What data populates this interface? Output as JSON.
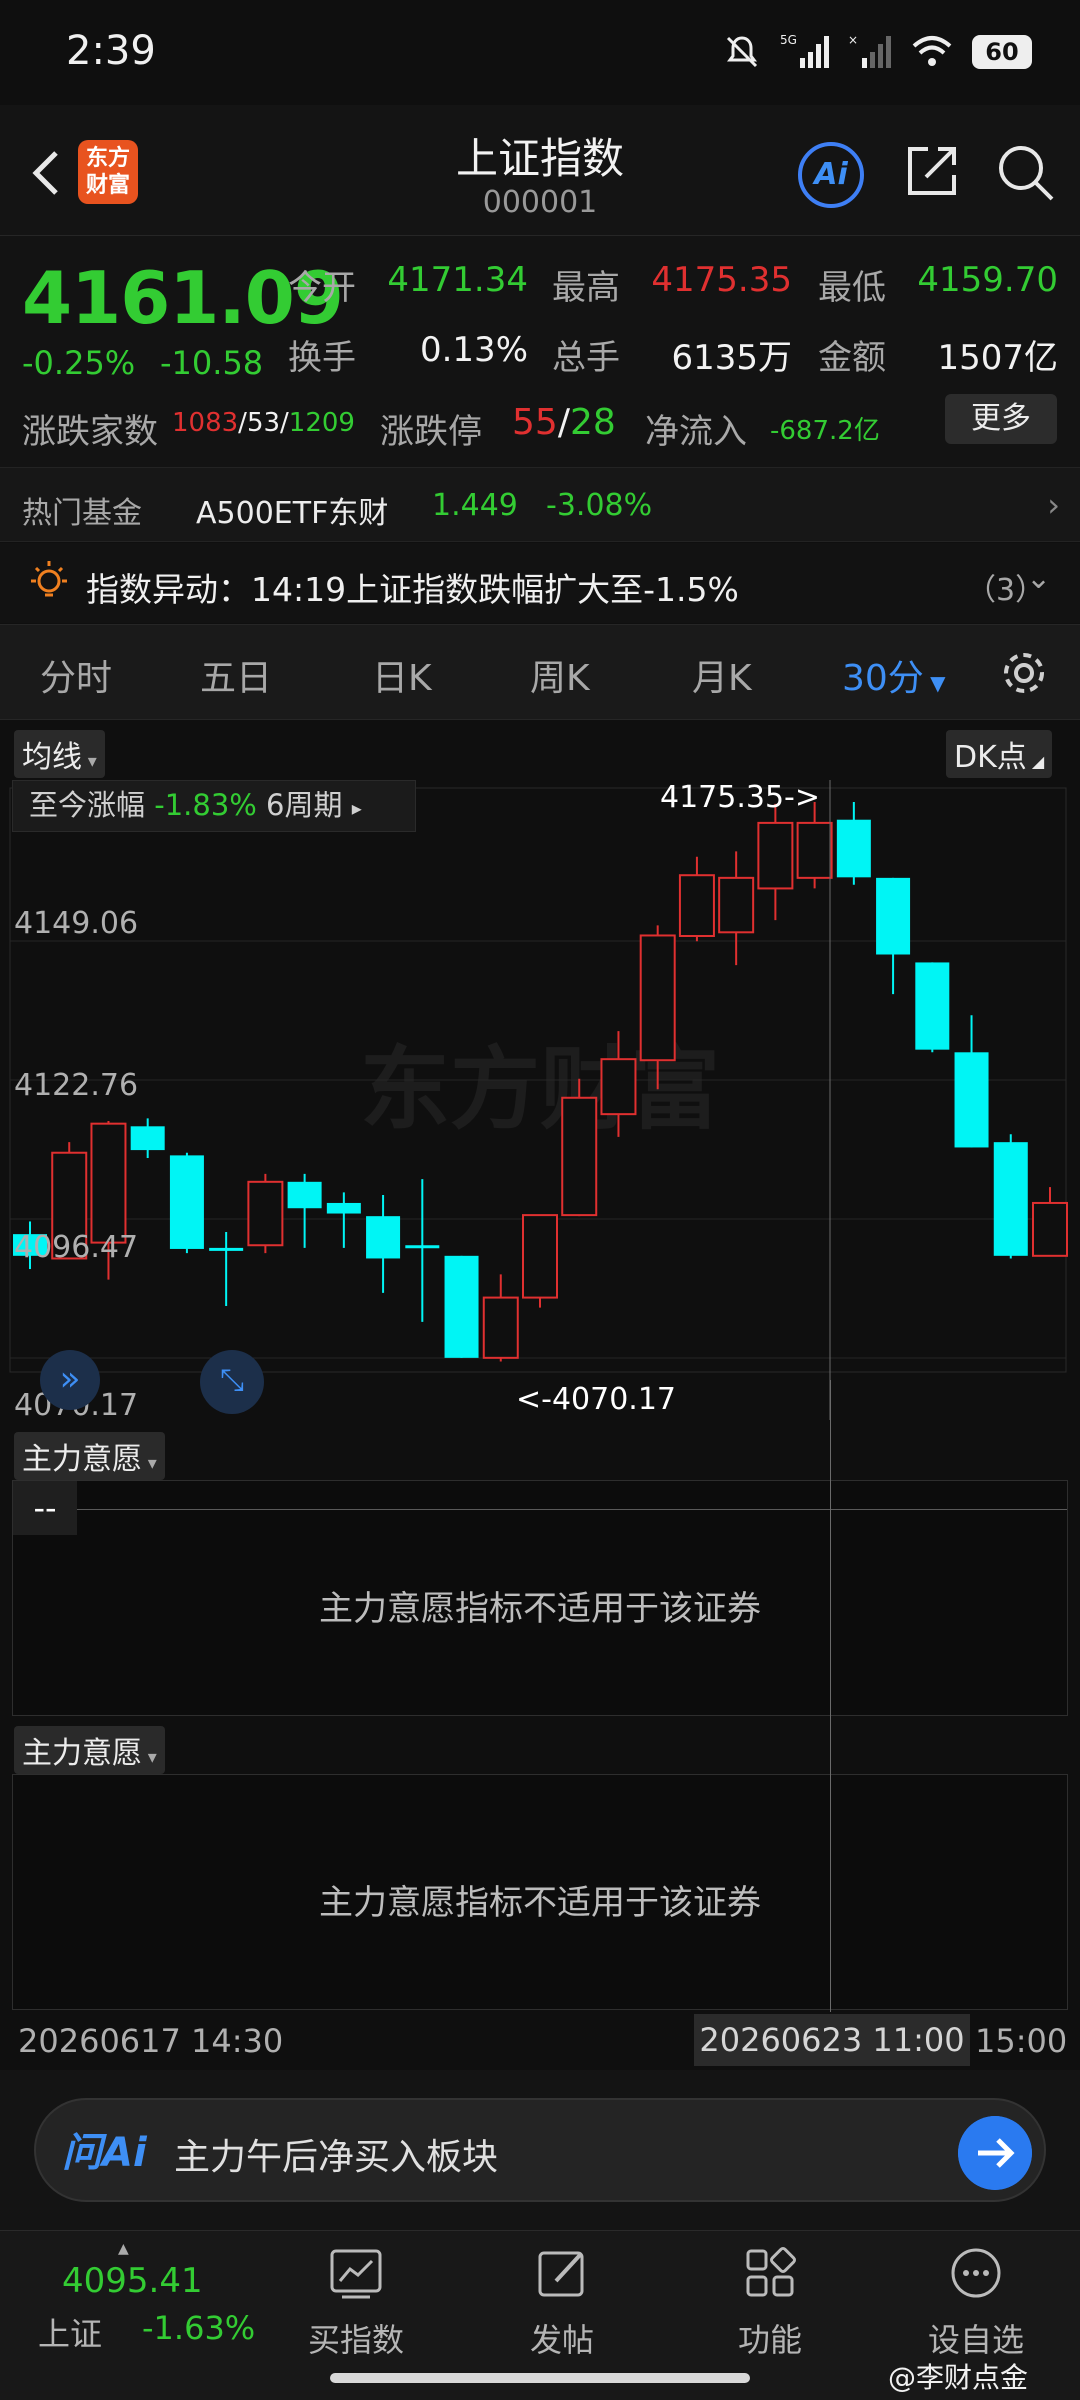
{
  "status": {
    "time": "2:39",
    "battery": "60",
    "network": "5G"
  },
  "header": {
    "logo_line1": "东方",
    "logo_line2": "财富",
    "title": "上证指数",
    "code": "000001",
    "ai_label": "Ai"
  },
  "quote": {
    "price": "4161.09",
    "change_pct": "-0.25%",
    "change_abs": "-10.58",
    "open_label": "今开",
    "open": "4171.34",
    "high_label": "最高",
    "high": "4175.35",
    "low_label": "最低",
    "low": "4159.70",
    "turnover_label": "换手",
    "turnover": "0.13%",
    "volume_label": "总手",
    "volume": "6135万",
    "amount_label": "金额",
    "amount": "1507亿",
    "breadth_label": "涨跌家数",
    "breadth_up": "1083",
    "breadth_flat": "53",
    "breadth_down": "1209",
    "limit_label": "涨跌停",
    "limit_up": "55",
    "limit_down": "28",
    "netflow_label": "净流入",
    "netflow": "-687.2亿",
    "more_label": "更多"
  },
  "fund": {
    "label": "热门基金",
    "name": "A500ETF东财",
    "price": "1.449",
    "change": "-3.08%"
  },
  "alert": {
    "text": "指数异动：14:19上证指数跌幅扩大至-1.5%",
    "count": "（3）"
  },
  "tabs": [
    "分时",
    "五日",
    "日K",
    "周K",
    "月K",
    "30分"
  ],
  "chart": {
    "ma_label": "均线",
    "dk_label": "DK点",
    "since_label": "至今涨幅",
    "since_value": "-1.83%",
    "since_periods": "6周期",
    "max_label": "4175.35->",
    "min_label": "<-4070.17",
    "y_ticks": [
      "4149.06",
      "4122.76",
      "4096.47",
      "4070.17"
    ],
    "colors": {
      "up": "#e03030",
      "down": "#00f5f5"
    }
  },
  "chart_data": {
    "type": "candlestick",
    "y_range": [
      4070.17,
      4175.35
    ],
    "y_ticks": [
      4149.06,
      4122.76,
      4096.47,
      4070.17
    ],
    "x_start": "20260617 14:30",
    "x_end": "15:00",
    "crosshair_x": "20260623 11:00",
    "max_marker": 4175.35,
    "min_marker": 4070.17,
    "candles": [
      {
        "o": 4093.6,
        "c": 4089.5,
        "h": 4096.0,
        "l": 4087.0
      },
      {
        "o": 4089.0,
        "c": 4109.0,
        "h": 4111.0,
        "l": 4089.0
      },
      {
        "o": 4092.0,
        "c": 4114.5,
        "h": 4115.0,
        "l": 4085.0
      },
      {
        "o": 4114.0,
        "c": 4109.5,
        "h": 4115.5,
        "l": 4108.0
      },
      {
        "o": 4108.5,
        "c": 4090.8,
        "h": 4109.0,
        "l": 4090.0
      },
      {
        "o": 4091.0,
        "c": 4091.0,
        "h": 4094.0,
        "l": 4080.0
      },
      {
        "o": 4091.5,
        "c": 4103.5,
        "h": 4105.0,
        "l": 4090.0
      },
      {
        "o": 4103.5,
        "c": 4098.5,
        "h": 4105.0,
        "l": 4091.0
      },
      {
        "o": 4099.5,
        "c": 4097.5,
        "h": 4101.5,
        "l": 4091.0
      },
      {
        "o": 4097.0,
        "c": 4089.0,
        "h": 4101.0,
        "l": 4082.5
      },
      {
        "o": 4091.5,
        "c": 4091.5,
        "h": 4104.0,
        "l": 4077.0
      },
      {
        "o": 4089.5,
        "c": 4070.2,
        "h": 4089.5,
        "l": 4070.2
      },
      {
        "o": 4070.2,
        "c": 4081.6,
        "h": 4086.0,
        "l": 4069.5
      },
      {
        "o": 4081.6,
        "c": 4097.2,
        "h": 4097.2,
        "l": 4079.7
      },
      {
        "o": 4097.2,
        "c": 4119.4,
        "h": 4123.0,
        "l": 4097.0
      },
      {
        "o": 4116.3,
        "c": 4126.7,
        "h": 4132.0,
        "l": 4112.0
      },
      {
        "o": 4126.5,
        "c": 4150.1,
        "h": 4152.0,
        "l": 4121.0
      },
      {
        "o": 4150.0,
        "c": 4161.5,
        "h": 4165.0,
        "l": 4149.0
      },
      {
        "o": 4150.7,
        "c": 4161.0,
        "h": 4166.0,
        "l": 4144.5
      },
      {
        "o": 4159.0,
        "c": 4171.4,
        "h": 4175.0,
        "l": 4153.0
      },
      {
        "o": 4161.0,
        "c": 4171.4,
        "h": 4175.35,
        "l": 4159.0
      },
      {
        "o": 4172.0,
        "c": 4161.1,
        "h": 4175.35,
        "l": 4159.7
      },
      {
        "o": 4161.0,
        "c": 4146.5,
        "h": 4161.0,
        "l": 4139.0
      },
      {
        "o": 4145.0,
        "c": 4128.5,
        "h": 4145.0,
        "l": 4128.0
      },
      {
        "o": 4128.0,
        "c": 4110.0,
        "h": 4135.0,
        "l": 4110.0
      },
      {
        "o": 4111.0,
        "c": 4089.5,
        "h": 4112.5,
        "l": 4089.0
      },
      {
        "o": 4089.5,
        "c": 4099.5,
        "h": 4102.5,
        "l": 4089.5
      }
    ]
  },
  "indicator": {
    "label": "主力意愿",
    "placeholder": "--",
    "message": "主力意愿指标不适用于该证券"
  },
  "dates": {
    "left": "20260617 14:30",
    "cross": "20260623 11:00",
    "right": "15:00"
  },
  "ask": {
    "logo": "问Ai",
    "prompt": "主力午后净买入板块"
  },
  "bottom_nav": {
    "index_value": "4095.41",
    "index_name": "上证",
    "index_change": "-1.63%",
    "items": [
      "买指数",
      "发帖",
      "功能",
      "设自选"
    ]
  },
  "watermark": "@李财点金"
}
